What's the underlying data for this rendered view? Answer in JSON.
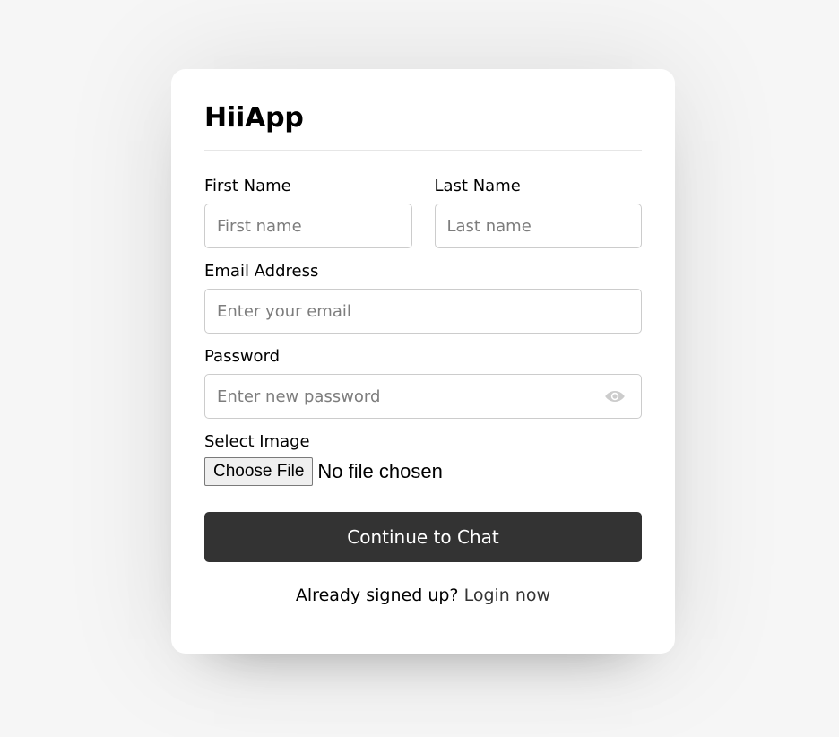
{
  "app": {
    "title": "HiiApp"
  },
  "form": {
    "first_name": {
      "label": "First Name",
      "placeholder": "First name",
      "value": ""
    },
    "last_name": {
      "label": "Last Name",
      "placeholder": "Last name",
      "value": ""
    },
    "email": {
      "label": "Email Address",
      "placeholder": "Enter your email",
      "value": ""
    },
    "password": {
      "label": "Password",
      "placeholder": "Enter new password",
      "value": "",
      "toggle_icon": "eye-icon"
    },
    "image": {
      "label": "Select Image",
      "button_label": "Choose File",
      "status": "No file chosen"
    },
    "submit_label": "Continue to Chat"
  },
  "footer": {
    "prompt": "Already signed up? ",
    "link_label": "Login now"
  },
  "colors": {
    "background": "#f6f6f6",
    "card": "#ffffff",
    "button": "#333333",
    "button_text": "#ffffff",
    "input_border": "#cccccc",
    "icon": "#cccccc"
  }
}
